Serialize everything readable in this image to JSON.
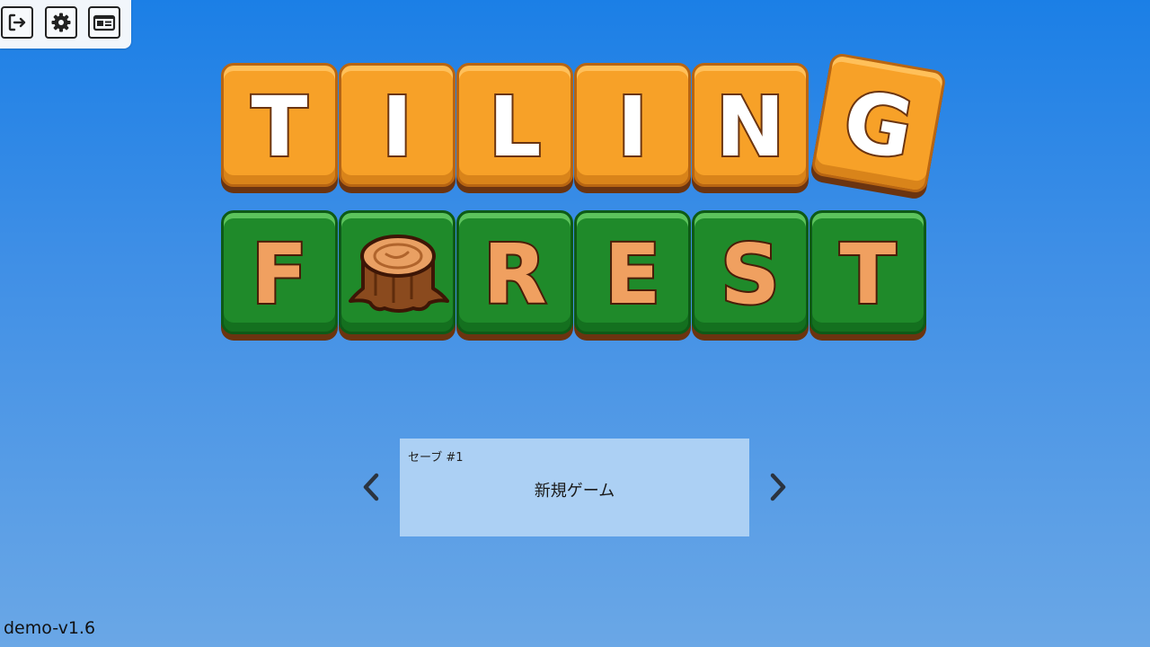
{
  "toolbar": {
    "buttons": [
      {
        "name": "exit",
        "icon": "exit-icon"
      },
      {
        "name": "settings",
        "icon": "gear-icon"
      },
      {
        "name": "credits",
        "icon": "id-card-icon"
      }
    ]
  },
  "title": {
    "line1": [
      "T",
      "I",
      "L",
      "I",
      "N",
      "G"
    ],
    "line2": [
      "F",
      "O",
      "R",
      "E",
      "S",
      "T"
    ],
    "line2_o_icon": "tree-stump-icon",
    "colors": {
      "line1_tile": "#f7a128",
      "line2_tile": "#1f8a2a",
      "line2_letter": "#f0a060"
    }
  },
  "save_selector": {
    "slot_label": "セーブ #1",
    "slot_title": "新規ゲーム",
    "prev_icon": "chevron-left-icon",
    "next_icon": "chevron-right-icon"
  },
  "version": "demo-v1.6",
  "colors": {
    "background_top": "#1b7fe6",
    "background_bottom": "#6aa7e6",
    "card": "#acd0f4"
  }
}
